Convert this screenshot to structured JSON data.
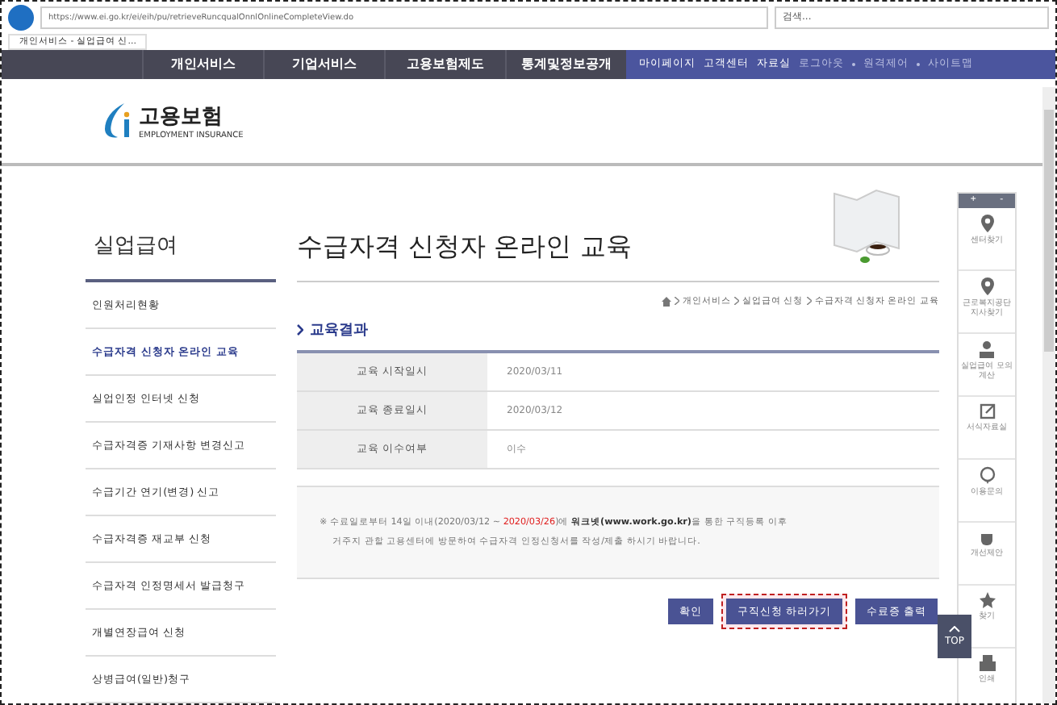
{
  "browser": {
    "url": "https://www.ei.go.kr/ei/eih/pu/retrieveRuncqualOnnlOnlineCompleteView.do",
    "search_placeholder": "검색...",
    "tab_title": "개인서비스 - 실업급여 신..."
  },
  "nav": {
    "items": [
      "개인서비스",
      "기업서비스",
      "고용보험제도",
      "통계및정보공개"
    ],
    "util": [
      "마이페이지",
      "고객센터",
      "자료실"
    ],
    "links": [
      "로그아웃",
      "원격제어",
      "사이트맵"
    ]
  },
  "logo": {
    "title": "고용보험",
    "subtitle": "EMPLOYMENT INSURANCE"
  },
  "sidebar": {
    "title": "실업급여",
    "items": [
      {
        "label": "인원처리현황",
        "selected": false
      },
      {
        "label": "수급자격 신청자 온라인 교육",
        "selected": true
      },
      {
        "label": "실업인정 인터넷 신청",
        "selected": false
      },
      {
        "label": "수급자격증 기재사항 변경신고",
        "selected": false
      },
      {
        "label": "수급기간 연기(변경) 신고",
        "selected": false
      },
      {
        "label": "수급자격증 재교부 신청",
        "selected": false
      },
      {
        "label": "수급자격 인정명세서 발급청구",
        "selected": false
      },
      {
        "label": "개별연장급여 신청",
        "selected": false
      },
      {
        "label": "상병급여(일반)청구",
        "selected": false
      }
    ]
  },
  "page": {
    "title": "수급자격 신청자 온라인 교육",
    "breadcrumb": [
      "개인서비스",
      "실업급여 신청",
      "수급자격 신청자 온라인 교육"
    ],
    "section": "교육결과",
    "rows": [
      {
        "label": "교육 시작일시",
        "value": "2020/03/11"
      },
      {
        "label": "교육 종료일시",
        "value": "2020/03/12"
      },
      {
        "label": "교육 이수여부",
        "value": "이수"
      }
    ],
    "notice": [
      [
        {
          "kind": "plain",
          "text": "※ 수료일로부터 14일 이내(2020/03/12 ~ "
        },
        {
          "kind": "red",
          "text": "2020/03/26"
        },
        {
          "kind": "plain",
          "text": ")에 "
        },
        {
          "kind": "bold",
          "text": "워크넷(www.work.go.kr)"
        },
        {
          "kind": "plain",
          "text": "을 통한 구직등록 이후"
        }
      ],
      [
        {
          "kind": "plain",
          "text": "거주지 관할 고용센터에 방문하여 수급자격 인정신청서를 작성/제출 하시기 바랍니다."
        }
      ]
    ],
    "buttons": [
      {
        "label": "확인",
        "highlighted": false
      },
      {
        "label": "구직신청 하러가기",
        "highlighted": true
      },
      {
        "label": "수료증 출력",
        "highlighted": false
      }
    ]
  },
  "quick": {
    "zoom": [
      "+",
      "-"
    ],
    "items": [
      {
        "label": "센터찾기",
        "kind": "pin"
      },
      {
        "label": "근로복지공단 지사찾기",
        "kind": "pin"
      },
      {
        "label": "실업급여 모의계산",
        "kind": "person"
      },
      {
        "label": "서식자료실",
        "kind": "edit"
      },
      {
        "label": "이용문의",
        "kind": "chat"
      },
      {
        "label": "개선제안",
        "kind": "cup"
      },
      {
        "label": "찾기",
        "kind": "star"
      },
      {
        "label": "인쇄",
        "kind": "print"
      }
    ],
    "top": "TOP"
  }
}
